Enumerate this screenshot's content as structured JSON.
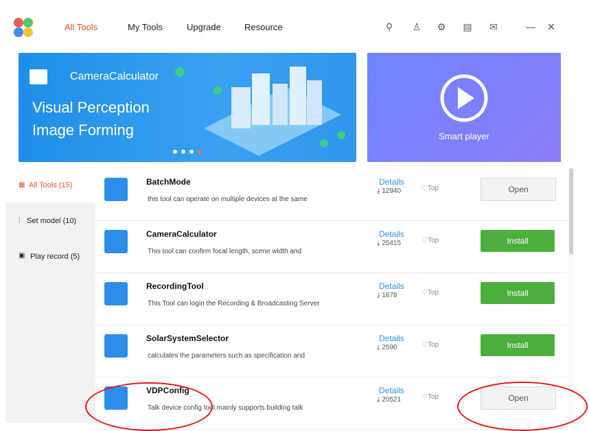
{
  "nav": {
    "all_tools": "All Tools",
    "my_tools": "My Tools",
    "upgrade": "Upgrade",
    "resource": "Resource"
  },
  "banner": {
    "product": "CameraCalculator",
    "line1": "Visual Perception",
    "line2": "Image Forming",
    "side": "Smart player"
  },
  "sidebar": {
    "items": [
      {
        "label": "All Tools (15)",
        "icon": "grid-icon"
      },
      {
        "label": "Set model (10)",
        "icon": "sliders-icon"
      },
      {
        "label": "Play record (5)",
        "icon": "play-square-icon"
      }
    ]
  },
  "tools": [
    {
      "name": "BatchMode",
      "desc": "this tool can operate on multiple devices at the same",
      "details": "Details",
      "downloads": "12940",
      "top": "Top",
      "action": "Open"
    },
    {
      "name": "CameraCalculator",
      "desc": "This tool can confirm focal length, scene width and",
      "details": "Details",
      "downloads": "25415",
      "top": "Top",
      "action": "Install"
    },
    {
      "name": "RecordingTool",
      "desc": "This Tool can login the Recording & Broadcasting Server",
      "details": "Details",
      "downloads": "1878",
      "top": "Top",
      "action": "Install"
    },
    {
      "name": "SolarSystemSelector",
      "desc": "calculates the parameters such as specification and",
      "details": "Details",
      "downloads": "2590",
      "top": "Top",
      "action": "Install"
    },
    {
      "name": "VDPConfig",
      "desc": "Talk device config tool mainly supports building talk",
      "details": "Details",
      "downloads": "20521",
      "top": "Top",
      "action": "Open"
    }
  ],
  "colors": {
    "accent": "#e8502d",
    "install": "#4cae3d",
    "link": "#2d8eea"
  }
}
